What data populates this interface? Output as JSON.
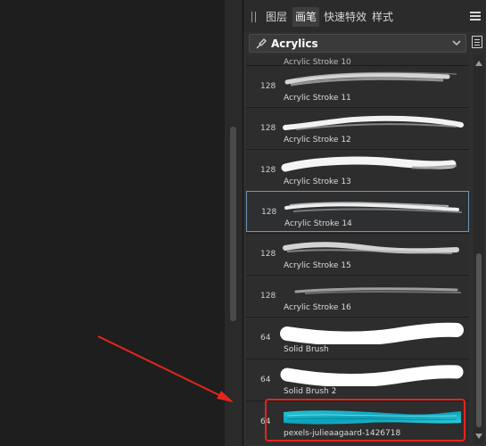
{
  "panel": {
    "tabs": [
      {
        "label": "图层",
        "active": false
      },
      {
        "label": "画笔",
        "active": true
      },
      {
        "label": "快速特效",
        "active": false
      },
      {
        "label": "样式",
        "active": false
      }
    ],
    "category": "Acrylics"
  },
  "brushes": {
    "partial_top": {
      "name": "Acrylic Stroke 10"
    },
    "items": [
      {
        "size": "128",
        "name": "Acrylic Stroke 11",
        "selected": false
      },
      {
        "size": "128",
        "name": "Acrylic Stroke 12",
        "selected": false
      },
      {
        "size": "128",
        "name": "Acrylic Stroke 13",
        "selected": false
      },
      {
        "size": "128",
        "name": "Acrylic Stroke 14",
        "selected": true
      },
      {
        "size": "128",
        "name": "Acrylic Stroke 15",
        "selected": false
      },
      {
        "size": "128",
        "name": "Acrylic Stroke 16",
        "selected": false
      },
      {
        "size": "64",
        "name": "Solid Brush",
        "selected": false
      },
      {
        "size": "64",
        "name": "Solid Brush 2",
        "selected": false
      },
      {
        "size": "64",
        "name": "pexels-julieaagaard-1426718",
        "selected": false
      }
    ]
  },
  "colors": {
    "annotation": "#e3261d",
    "selection_border": "#6e97b7",
    "texture_brush": "#19b4c8"
  }
}
